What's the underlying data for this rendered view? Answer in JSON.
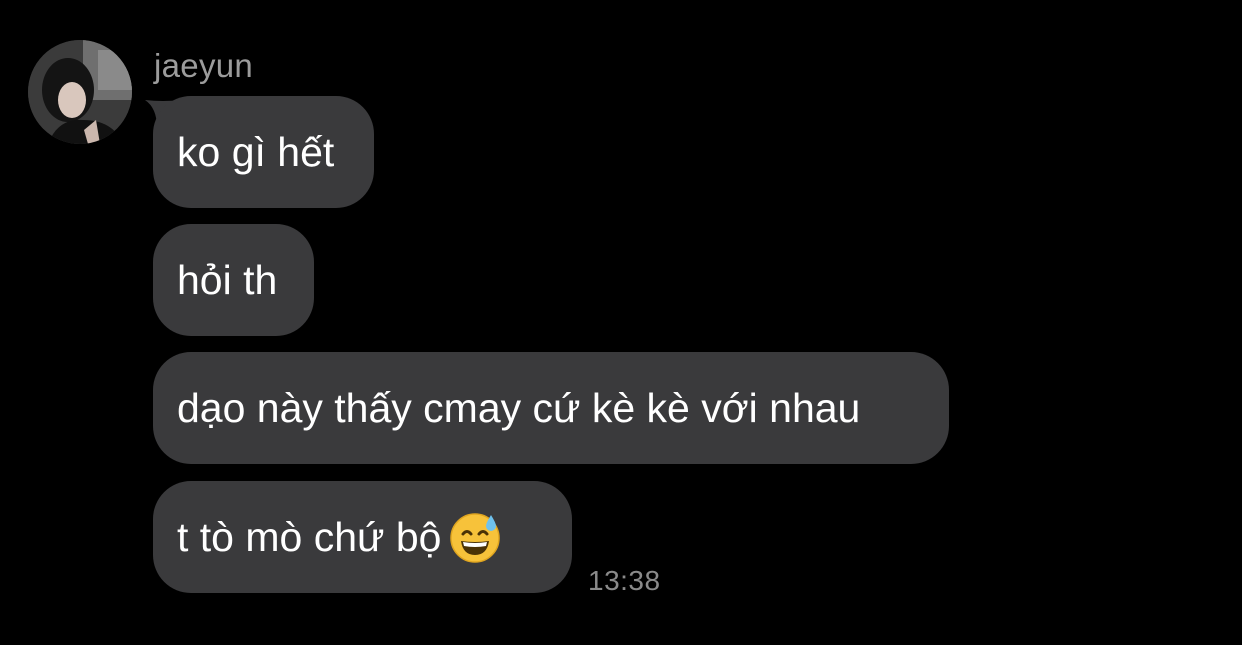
{
  "chat": {
    "sender_name": "jaeyun",
    "avatar": "profile-photo",
    "messages": [
      {
        "text": "ko gì hết"
      },
      {
        "text": "hỏi th"
      },
      {
        "text": "dạo này thấy cmay cứ kè kè với nhau"
      },
      {
        "text": "t tò mò chứ bộ",
        "emoji": "grinning-face-with-sweat"
      }
    ],
    "timestamp": "13:38"
  },
  "colors": {
    "background": "#000000",
    "bubble": "#3a3a3c",
    "message_text": "#ffffff",
    "sender_name": "#9c9c9c",
    "timestamp": "#8a8a8a"
  }
}
